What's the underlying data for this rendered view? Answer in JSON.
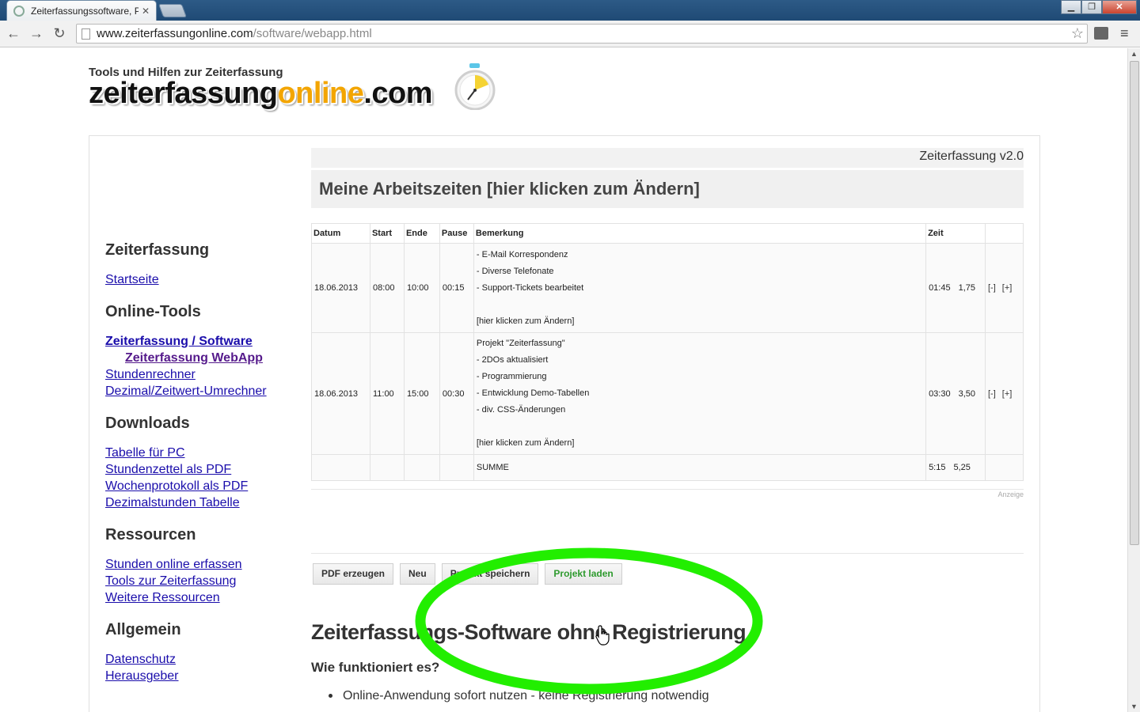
{
  "browser": {
    "tab_title": "Zeiterfassungssoftware, P",
    "tab_close": "✕",
    "url_host": "www.zeiterfassungonline.com",
    "url_path": "/software/webapp.html",
    "back": "←",
    "forward": "→",
    "reload": "↻",
    "star": "☆",
    "menu": "≡",
    "win_minimize": "▁",
    "win_restore": "❐",
    "win_close": "✕"
  },
  "logo": {
    "tagline": "Tools und Hilfen zur Zeiterfassung",
    "part1": "zeiterfassung",
    "part2": "online",
    "part3": ".com"
  },
  "sidebar": {
    "sections": [
      {
        "heading": "Zeiterfassung",
        "links": [
          {
            "label": "Startseite"
          }
        ]
      },
      {
        "heading": "Online-Tools",
        "links": [
          {
            "label": "Zeiterfassung / Software"
          },
          {
            "label": "Zeiterfassung WebApp"
          },
          {
            "label": "Stundenrechner"
          },
          {
            "label": "Dezimal/Zeitwert-Umrechner"
          }
        ]
      },
      {
        "heading": "Downloads",
        "links": [
          {
            "label": "Tabelle für PC"
          },
          {
            "label": "Stundenzettel als PDF"
          },
          {
            "label": "Wochenprotokoll als PDF"
          },
          {
            "label": "Dezimalstunden Tabelle"
          }
        ]
      },
      {
        "heading": "Ressourcen",
        "links": [
          {
            "label": "Stunden online erfassen"
          },
          {
            "label": "Tools zur Zeiterfassung"
          },
          {
            "label": "Weitere Ressourcen"
          }
        ]
      },
      {
        "heading": "Allgemein",
        "links": [
          {
            "label": "Datenschutz"
          },
          {
            "label": "Herausgeber"
          }
        ]
      }
    ]
  },
  "app": {
    "version": "Zeiterfassung v2.0",
    "title": "Meine Arbeitszeiten [hier klicken zum Ändern]",
    "columns": {
      "datum": "Datum",
      "start": "Start",
      "ende": "Ende",
      "pause": "Pause",
      "bemerkung": "Bemerkung",
      "zeit": "Zeit"
    },
    "rows": [
      {
        "datum": "18.06.2013",
        "start": "08:00",
        "ende": "10:00",
        "pause": "00:15",
        "remarks": [
          "- E-Mail Korrespondenz",
          "- Diverse Telefonate",
          "- Support-Tickets bearbeitet",
          "",
          "[hier klicken zum Ändern]"
        ],
        "zeit": "01:45",
        "dezimal": "1,75",
        "minus": "[-]",
        "plus": "[+]"
      },
      {
        "datum": "18.06.2013",
        "start": "11:00",
        "ende": "15:00",
        "pause": "00:30",
        "remarks": [
          "Projekt \"Zeiterfassung\"",
          "- 2DOs aktualisiert",
          "- Programmierung",
          "- Entwicklung Demo-Tabellen",
          "- div. CSS-Änderungen",
          "",
          "[hier klicken zum Ändern]"
        ],
        "zeit": "03:30",
        "dezimal": "3,50",
        "minus": "[-]",
        "plus": "[+]"
      }
    ],
    "sum": {
      "label": "SUMME",
      "zeit": "5:15",
      "dezimal": "5,25"
    },
    "anzeige": "Anzeige",
    "buttons": {
      "pdf": "PDF erzeugen",
      "neu": "Neu",
      "save": "Projekt speichern",
      "load": "Projekt laden"
    }
  },
  "content": {
    "h2": "Zeiterfassungs-Software ohne Registrierung",
    "h3": "Wie funktioniert es?",
    "bullets": [
      "Online-Anwendung sofort nutzen - keine Registrierung notwendig"
    ]
  },
  "colors": {
    "annotation": "#22ee00",
    "accent": "#f3a500",
    "link": "#1a0dab"
  }
}
